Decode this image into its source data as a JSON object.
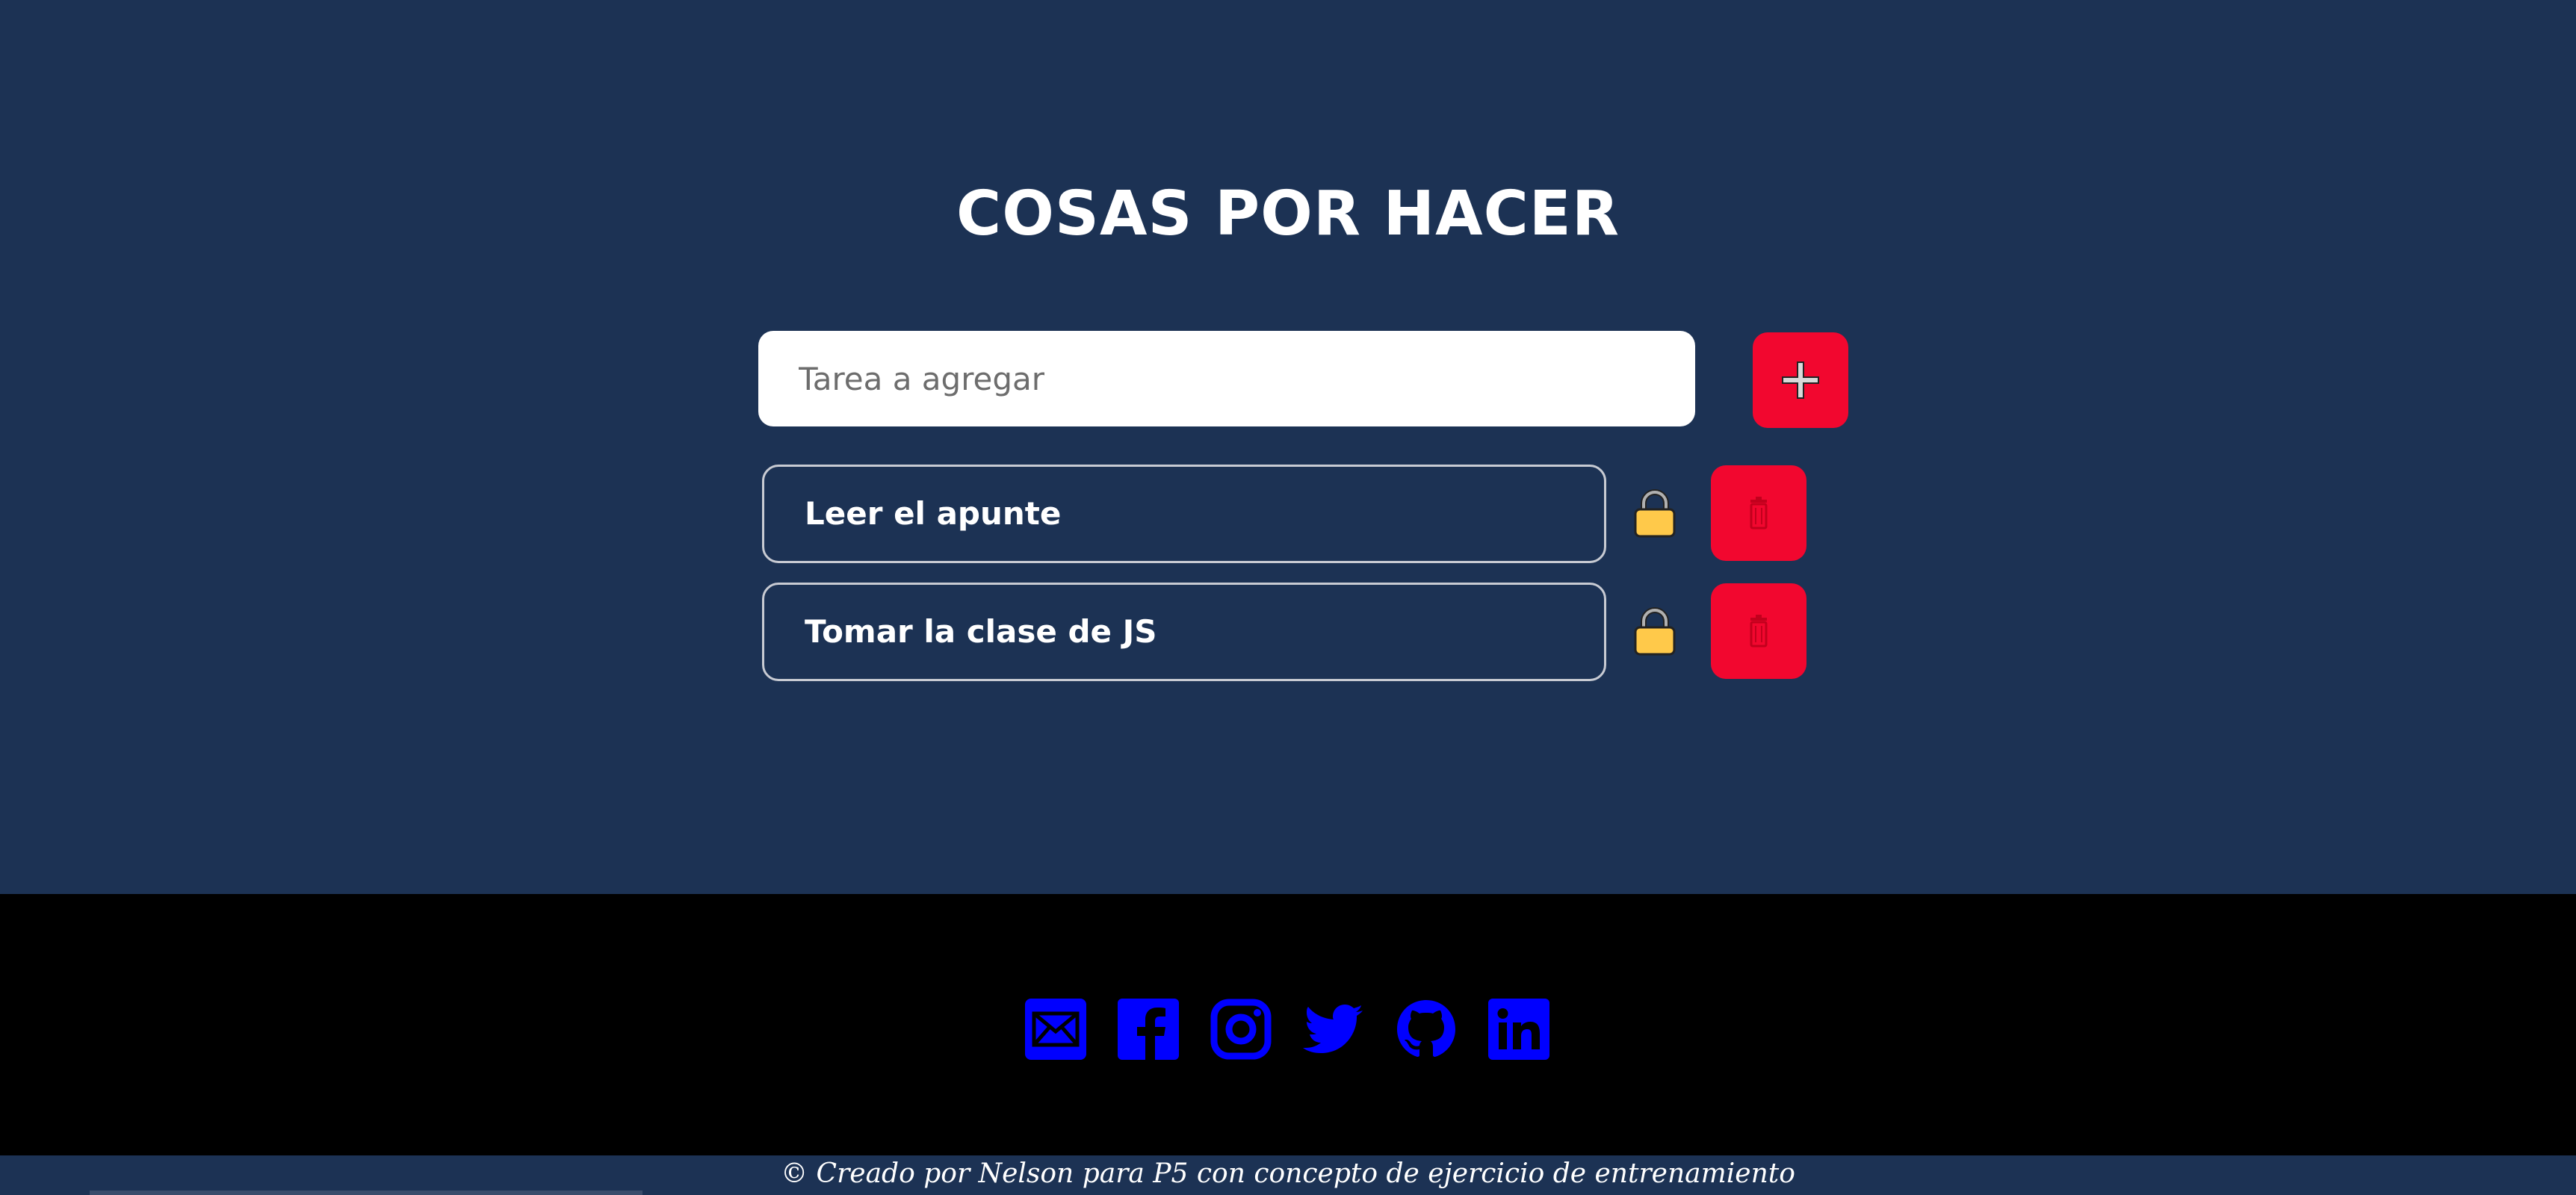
{
  "page": {
    "title": "COSAS POR HACER"
  },
  "form": {
    "input_value": "",
    "input_placeholder": "Tarea a agregar",
    "add_icon": "plus-icon"
  },
  "tasks": [
    {
      "text": "Leer el apunte",
      "lock_icon": "lock-icon",
      "delete_icon": "trash-icon"
    },
    {
      "text": "Tomar la clase de JS",
      "lock_icon": "lock-icon",
      "delete_icon": "trash-icon"
    }
  ],
  "footer": {
    "social_icons": [
      "email-icon",
      "facebook-icon",
      "instagram-icon",
      "twitter-icon",
      "github-icon",
      "linkedin-icon"
    ],
    "credit": "© Creado por Nelson para P5 con concepto de ejercicio de entrenamiento"
  },
  "colors": {
    "background": "#1c3254",
    "accent": "#f2072f",
    "lock": "#ffc94a",
    "social": "#0000ff",
    "footer": "#000000"
  }
}
